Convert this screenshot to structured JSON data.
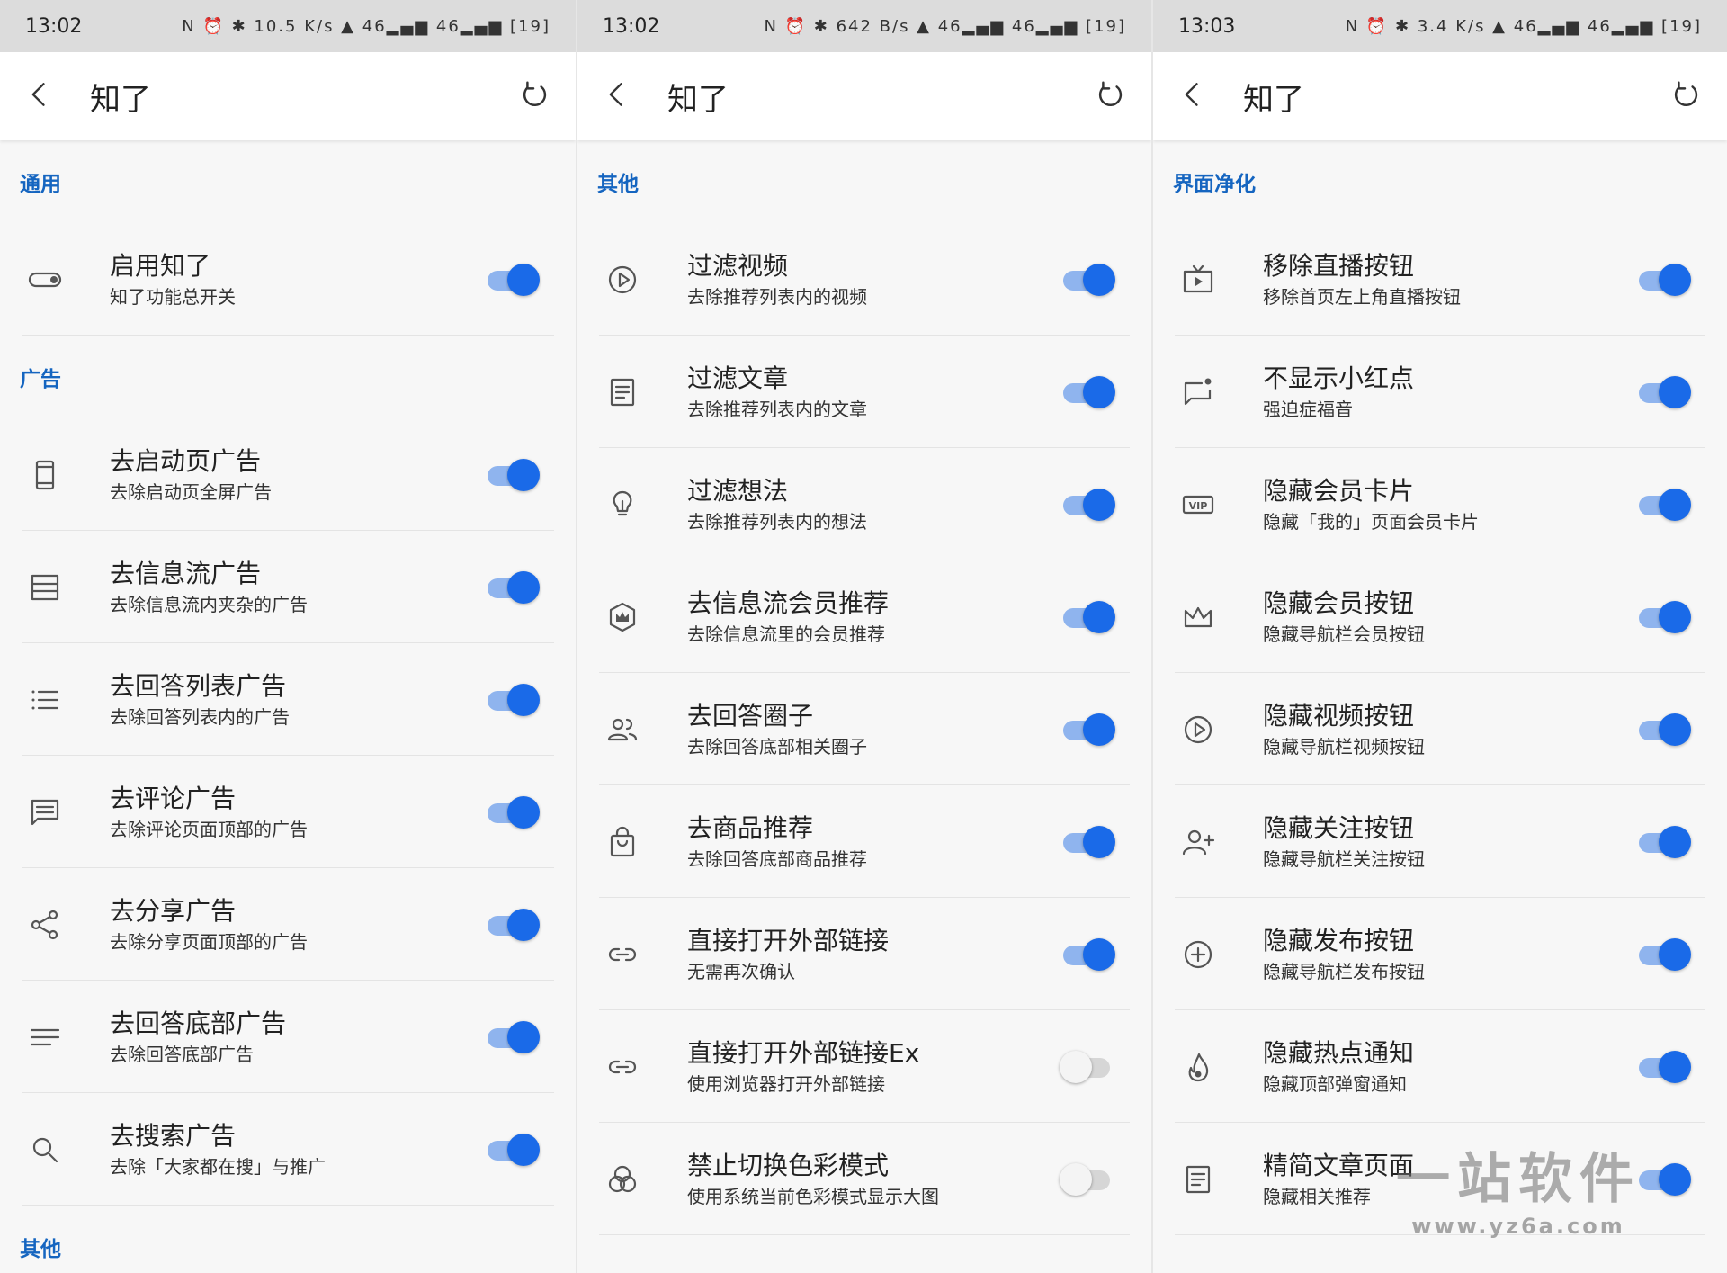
{
  "screens": [
    {
      "status": {
        "time": "13:02",
        "right": "N ⏰ ✱ 10.5 K/s ▲ 46▂▄▆ 46▂▄▆ [19]"
      },
      "title": "知了",
      "sections": [
        {
          "header": "通用",
          "items": [
            {
              "title": "启用知了",
              "sub": "知了功能总开关",
              "icon": "toggle-icon",
              "on": true
            }
          ]
        },
        {
          "header": "广告",
          "items": [
            {
              "title": "去启动页广告",
              "sub": "去除启动页全屏广告",
              "icon": "phone-icon",
              "on": true
            },
            {
              "title": "去信息流广告",
              "sub": "去除信息流内夹杂的广告",
              "icon": "feed-icon",
              "on": true
            },
            {
              "title": "去回答列表广告",
              "sub": "去除回答列表内的广告",
              "icon": "list-icon",
              "on": true
            },
            {
              "title": "去评论广告",
              "sub": "去除评论页面顶部的广告",
              "icon": "comment-icon",
              "on": true
            },
            {
              "title": "去分享广告",
              "sub": "去除分享页面顶部的广告",
              "icon": "share-icon",
              "on": true
            },
            {
              "title": "去回答底部广告",
              "sub": "去除回答底部广告",
              "icon": "lines-icon",
              "on": true
            },
            {
              "title": "去搜索广告",
              "sub": "去除「大家都在搜」与推广",
              "icon": "search-icon",
              "on": true
            }
          ]
        },
        {
          "header": "其他",
          "items": []
        }
      ]
    },
    {
      "status": {
        "time": "13:02",
        "right": "N ⏰ ✱ 642 B/s ▲ 46▂▄▆ 46▂▄▆ [19]"
      },
      "title": "知了",
      "sections": [
        {
          "header": "其他",
          "items": [
            {
              "title": "过滤视频",
              "sub": "去除推荐列表内的视频",
              "icon": "play-icon",
              "on": true
            },
            {
              "title": "过滤文章",
              "sub": "去除推荐列表内的文章",
              "icon": "article-icon",
              "on": true
            },
            {
              "title": "过滤想法",
              "sub": "去除推荐列表内的想法",
              "icon": "bulb-icon",
              "on": true
            },
            {
              "title": "去信息流会员推荐",
              "sub": "去除信息流里的会员推荐",
              "icon": "crown-badge-icon",
              "on": true
            },
            {
              "title": "去回答圈子",
              "sub": "去除回答底部相关圈子",
              "icon": "group-icon",
              "on": true
            },
            {
              "title": "去商品推荐",
              "sub": "去除回答底部商品推荐",
              "icon": "bag-icon",
              "on": true
            },
            {
              "title": "直接打开外部链接",
              "sub": "无需再次确认",
              "icon": "link-icon",
              "on": true
            },
            {
              "title": "直接打开外部链接Ex",
              "sub": "使用浏览器打开外部链接",
              "icon": "link-icon",
              "on": false
            },
            {
              "title": "禁止切换色彩模式",
              "sub": "使用系统当前色彩模式显示大图",
              "icon": "color-icon",
              "on": false
            }
          ]
        }
      ]
    },
    {
      "status": {
        "time": "13:03",
        "right": "N ⏰ ✱ 3.4 K/s ▲ 46▂▄▆ 46▂▄▆ [19]"
      },
      "title": "知了",
      "sections": [
        {
          "header": "界面净化",
          "items": [
            {
              "title": "移除直播按钮",
              "sub": "移除首页左上角直播按钮",
              "icon": "tv-icon",
              "on": true
            },
            {
              "title": "不显示小红点",
              "sub": "强迫症福音",
              "icon": "dot-message-icon",
              "on": true
            },
            {
              "title": "隐藏会员卡片",
              "sub": "隐藏「我的」页面会员卡片",
              "icon": "vip-icon",
              "on": true
            },
            {
              "title": "隐藏会员按钮",
              "sub": "隐藏导航栏会员按钮",
              "icon": "crown-icon",
              "on": true
            },
            {
              "title": "隐藏视频按钮",
              "sub": "隐藏导航栏视频按钮",
              "icon": "play-icon",
              "on": true
            },
            {
              "title": "隐藏关注按钮",
              "sub": "隐藏导航栏关注按钮",
              "icon": "person-add-icon",
              "on": true
            },
            {
              "title": "隐藏发布按钮",
              "sub": "隐藏导航栏发布按钮",
              "icon": "plus-circle-icon",
              "on": true
            },
            {
              "title": "隐藏热点通知",
              "sub": "隐藏顶部弹窗通知",
              "icon": "flame-icon",
              "on": true
            },
            {
              "title": "精简文章页面",
              "sub": "隐藏相关推荐",
              "icon": "article-icon",
              "on": true
            }
          ]
        }
      ]
    }
  ],
  "watermark": {
    "main": "一站软件",
    "sub": "www.yz6a.com"
  }
}
